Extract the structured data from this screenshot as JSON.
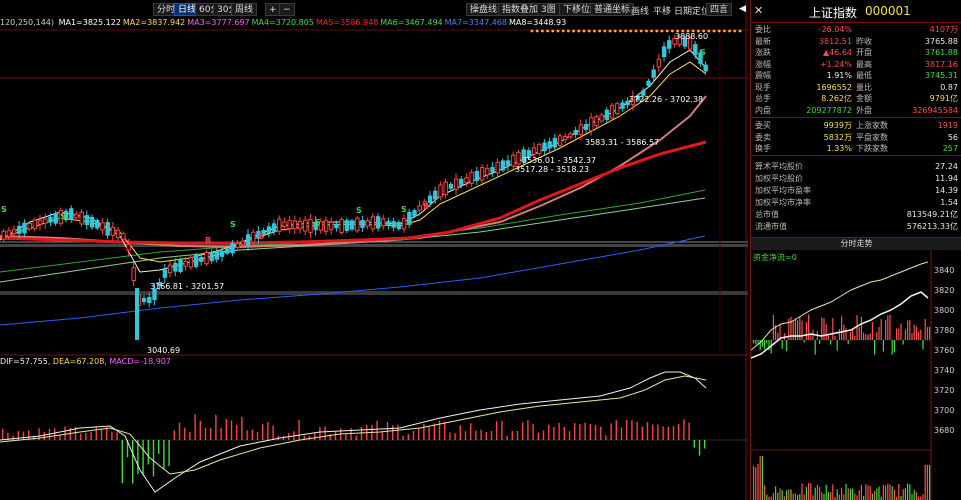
{
  "toolbar": {
    "period_buttons": [
      "分时",
      "日线",
      "60分",
      "30分",
      "周线"
    ],
    "active_period": "日线",
    "plus": "+",
    "minus": "−",
    "right_buttons": [
      "操盘线",
      "指数叠加",
      "3图",
      "下移位",
      "普通坐标",
      "画线",
      "平移",
      "日期定位",
      "四言"
    ],
    "arrow_left": "◀",
    "close": "✕"
  },
  "ma_legend": {
    "prefix": "120,250,144)",
    "items": [
      {
        "label": "MA1=3825.122",
        "color": "#ffffff"
      },
      {
        "label": "MA2=3837.942",
        "color": "#ffdf3f"
      },
      {
        "label": "MA3=3777.697",
        "color": "#ff5cff"
      },
      {
        "label": "MA4=3720.805",
        "color": "#3ddc3d"
      },
      {
        "label": "MA5=3586.948",
        "color": "#ff2020"
      },
      {
        "label": "MA6=3467.494",
        "color": "#3ddc3d"
      },
      {
        "label": "MA7=3347.468",
        "color": "#4a80ff"
      },
      {
        "label": "MA8=3448.93",
        "color": "#ffffff"
      }
    ]
  },
  "annotations": {
    "high": "3888.60",
    "a1": "3722.26 - 3702.38",
    "a2": "3583.31 - 3586.57",
    "a3": "3536.01 - 3542.37",
    "a4": "3517.28 - 3518.23",
    "a5": "3166.81 - 3201.57",
    "low": "3040.69",
    "marks": [
      "S",
      "B",
      "S",
      "B",
      "S",
      "S",
      "S",
      "B",
      "S",
      "S"
    ]
  },
  "macd_legend": {
    "dif": "DIF=57.755",
    "dea": "DEA=67.208",
    "macd": "MACD=-18.907"
  },
  "quote": {
    "name": "上证指数",
    "code": "000001",
    "rows": [
      {
        "l1": "委比",
        "v1": "-26.04%",
        "c1": "red",
        "l2": "",
        "v2": "4107万",
        "c2": "red"
      },
      {
        "l1": "最新",
        "v1": "3812.51",
        "c1": "red",
        "l2": "昨收",
        "v2": "3765.88",
        "c2": "wht"
      },
      {
        "l1": "涨跌",
        "v1": "▲46.64",
        "c1": "red",
        "l2": "开盘",
        "v2": "3761.88",
        "c2": "grn"
      },
      {
        "l1": "涨幅",
        "v1": "+1.24%",
        "c1": "red",
        "l2": "最高",
        "v2": "3817.16",
        "c2": "red"
      },
      {
        "l1": "震幅",
        "v1": "1.91%",
        "c1": "wht",
        "l2": "最低",
        "v2": "3745.31",
        "c2": "grn"
      },
      {
        "l1": "现手",
        "v1": "1696552",
        "c1": "yel",
        "l2": "量比",
        "v2": "0.87",
        "c2": "wht"
      },
      {
        "l1": "总手",
        "v1": "8.262亿",
        "c1": "yel",
        "l2": "金额",
        "v2": "9791亿",
        "c2": "yel"
      },
      {
        "l1": "内盘",
        "v1": "209277872",
        "c1": "grn",
        "l2": "外盘",
        "v2": "326945584",
        "c2": "red"
      },
      {
        "l1": "委买",
        "v1": "9939万",
        "c1": "yel",
        "l2": "上涨家数",
        "v2": "1919",
        "c2": "red"
      },
      {
        "l1": "委卖",
        "v1": "5832万",
        "c1": "yel",
        "l2": "平盘家数",
        "v2": "56",
        "c2": "wht"
      },
      {
        "l1": "换手",
        "v1": "1.33%",
        "c1": "yel",
        "l2": "下跌家数",
        "v2": "257",
        "c2": "grn"
      }
    ],
    "stats": [
      {
        "l": "算术平均股价",
        "v": "27.24"
      },
      {
        "l": "加权平均股价",
        "v": "11.94"
      },
      {
        "l": "加权平均市盈率",
        "v": "14.39"
      },
      {
        "l": "加权平均市净率",
        "v": "1.54"
      },
      {
        "l": "总市值",
        "v": "813549.21亿"
      },
      {
        "l": "流通市值",
        "v": "576213.33亿"
      }
    ],
    "tab": "分时走势",
    "mini_label": "资金净流=0",
    "mini_ticks": [
      "3840",
      "3820",
      "3800",
      "3780",
      "3760",
      "3740",
      "3720",
      "3700",
      "3680"
    ]
  }
}
